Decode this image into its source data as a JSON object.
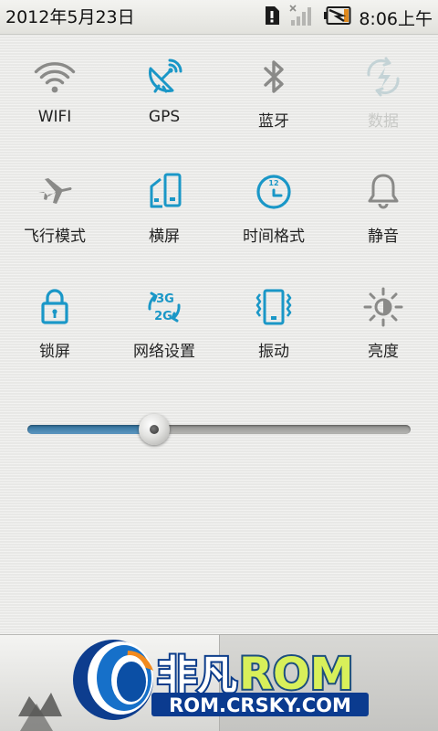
{
  "status_bar": {
    "date": "2012年5月23日",
    "time": "8:06上午",
    "icons": [
      "sd-card-icon",
      "no-signal-icon",
      "battery-charging-icon"
    ]
  },
  "toggles": [
    {
      "id": "wifi",
      "label": "WIFI",
      "icon": "wifi-icon",
      "enabled": false,
      "disabled": false
    },
    {
      "id": "gps",
      "label": "GPS",
      "icon": "gps-satellite-icon",
      "enabled": true,
      "disabled": false
    },
    {
      "id": "bluetooth",
      "label": "蓝牙",
      "icon": "bluetooth-icon",
      "enabled": false,
      "disabled": false
    },
    {
      "id": "data",
      "label": "数据",
      "icon": "mobile-data-icon",
      "enabled": false,
      "disabled": true
    },
    {
      "id": "airplane",
      "label": "飞行模式",
      "icon": "airplane-icon",
      "enabled": false,
      "disabled": false
    },
    {
      "id": "rotation",
      "label": "横屏",
      "icon": "screen-rotation-icon",
      "enabled": true,
      "disabled": false
    },
    {
      "id": "time_format",
      "label": "时间格式",
      "icon": "clock-icon",
      "enabled": true,
      "disabled": false
    },
    {
      "id": "silent",
      "label": "静音",
      "icon": "bell-icon",
      "enabled": false,
      "disabled": false
    },
    {
      "id": "lock_screen",
      "label": "锁屏",
      "icon": "padlock-icon",
      "enabled": true,
      "disabled": false
    },
    {
      "id": "network",
      "label": "网络设置",
      "icon": "3g-2g-switch-icon",
      "enabled": true,
      "disabled": false
    },
    {
      "id": "vibrate",
      "label": "振动",
      "icon": "vibrate-icon",
      "enabled": true,
      "disabled": false
    },
    {
      "id": "brightness",
      "label": "亮度",
      "icon": "brightness-sun-icon",
      "enabled": false,
      "disabled": false
    }
  ],
  "network_icon_text": {
    "top": "3G",
    "bottom": "2G"
  },
  "clock_icon_text": "12",
  "brightness": {
    "level": 0.33
  },
  "watermark": {
    "title_cn": "非凡",
    "title_en": "ROM",
    "url": "ROM.CRSKY.COM"
  },
  "colors": {
    "accent": "#1a97c7",
    "inactive": "#8a8a88",
    "disabled": "#c4d3d6",
    "slider_fill": "#3f7faa"
  }
}
